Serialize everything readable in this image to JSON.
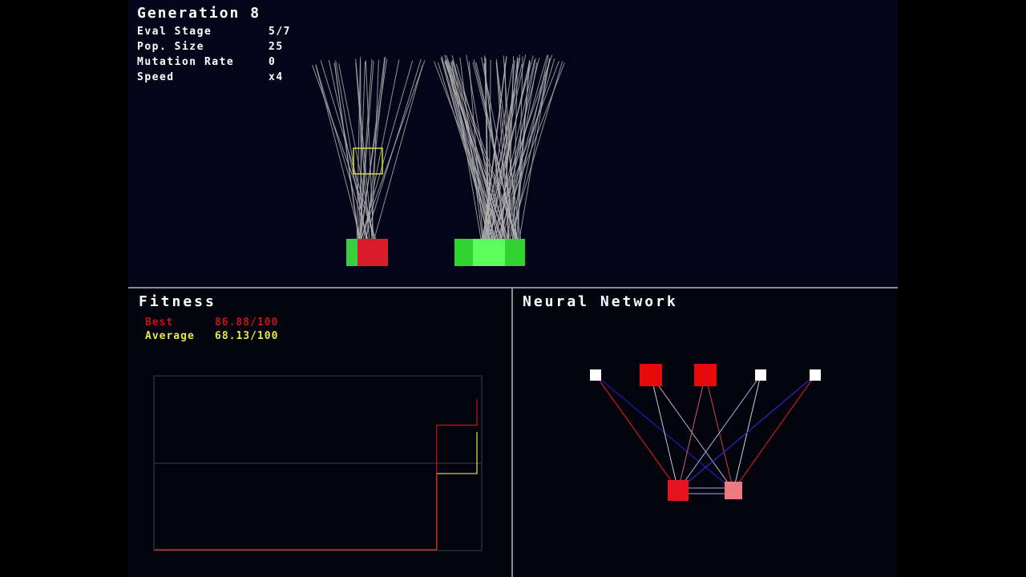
{
  "stats": {
    "generation": "Generation 8",
    "rows": [
      {
        "label": "Eval Stage",
        "value": "5/7"
      },
      {
        "label": "Pop. Size",
        "value": "25"
      },
      {
        "label": "Mutation Rate",
        "value": "0"
      },
      {
        "label": "Speed",
        "value": "x4"
      }
    ]
  },
  "fitness": {
    "title": "Fitness",
    "best_label": "Best",
    "best_value": "86.88/100",
    "average_label": "Average",
    "average_value": "68.13/100"
  },
  "network": {
    "title": "Neural Network"
  },
  "colors": {
    "best": "#c81515",
    "average": "#e6e64a",
    "background": "#05051a"
  },
  "chart_data": {
    "type": "line",
    "title": "",
    "xlabel": "",
    "ylabel": "",
    "ylim": [
      0,
      100
    ],
    "x": [
      0,
      1,
      2,
      3,
      4,
      5,
      6,
      7,
      8
    ],
    "series": [
      {
        "name": "Best",
        "values": [
          0,
          0,
          0,
          0,
          0,
          0,
          0,
          72,
          87
        ]
      },
      {
        "name": "Average",
        "values": [
          0,
          0,
          0,
          0,
          0,
          0,
          0,
          44,
          68
        ]
      }
    ]
  }
}
